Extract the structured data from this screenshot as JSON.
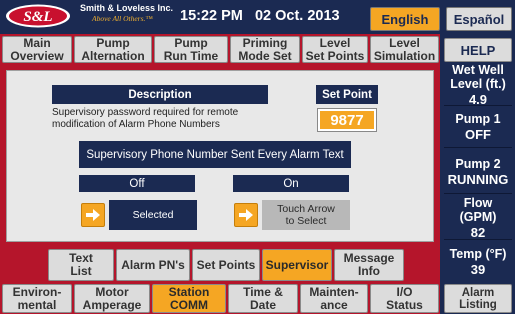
{
  "header": {
    "logo_text": "S&L",
    "company": "Smith & Loveless Inc.",
    "tagline": "Above All Others.™",
    "time": "15:22 PM",
    "date": "02 Oct. 2013",
    "lang_english": "English",
    "lang_espanol": "Español"
  },
  "top_tabs": [
    {
      "label": "Main\nOverview"
    },
    {
      "label": "Pump\nAlternation"
    },
    {
      "label": "Pump\nRun Time"
    },
    {
      "label": "Priming\nMode Set"
    },
    {
      "label": "Level\nSet Points"
    },
    {
      "label": "Level\nSimulation"
    }
  ],
  "help_label": "HELP",
  "panel": {
    "description_header": "Description",
    "setpoint_header": "Set Point",
    "description_text": "Supervisory password required for remote\nmodification of Alarm Phone Numbers",
    "setpoint_value": "9877",
    "phone_banner": "Supervisory Phone Number Sent Every Alarm Text",
    "off_label": "Off",
    "on_label": "On",
    "selected_label": "Selected",
    "touch_label": "Touch Arrow\nto Select"
  },
  "sub_tabs": [
    {
      "label": "Text\nList",
      "active": false
    },
    {
      "label": "Alarm PN's",
      "active": false
    },
    {
      "label": "Set Points",
      "active": false
    },
    {
      "label": "Supervisor",
      "active": true
    },
    {
      "label": "Message\nInfo",
      "active": false
    }
  ],
  "bottom_tabs": [
    {
      "label": "Environ-\nmental",
      "active": false
    },
    {
      "label": "Motor\nAmperage",
      "active": false
    },
    {
      "label": "Station\nCOMM",
      "active": true
    },
    {
      "label": "Time &\nDate",
      "active": false
    },
    {
      "label": "Mainten-\nance",
      "active": false
    },
    {
      "label": "I/O\nStatus",
      "active": false
    }
  ],
  "status": [
    {
      "label": "Wet Well\nLevel (ft.)",
      "value": "4.9"
    },
    {
      "label": "Pump 1",
      "value": "OFF"
    },
    {
      "label": "Pump 2",
      "value": "RUNNING"
    },
    {
      "label": "Flow (GPM)",
      "value": "82"
    },
    {
      "label": "Temp (°F)",
      "value": "39"
    }
  ],
  "alarm_listing": "Alarm\nListing",
  "colors": {
    "navy": "#1b2a52",
    "red": "#b5152b",
    "orange": "#f5a623",
    "grey": "#dcdcdc"
  }
}
